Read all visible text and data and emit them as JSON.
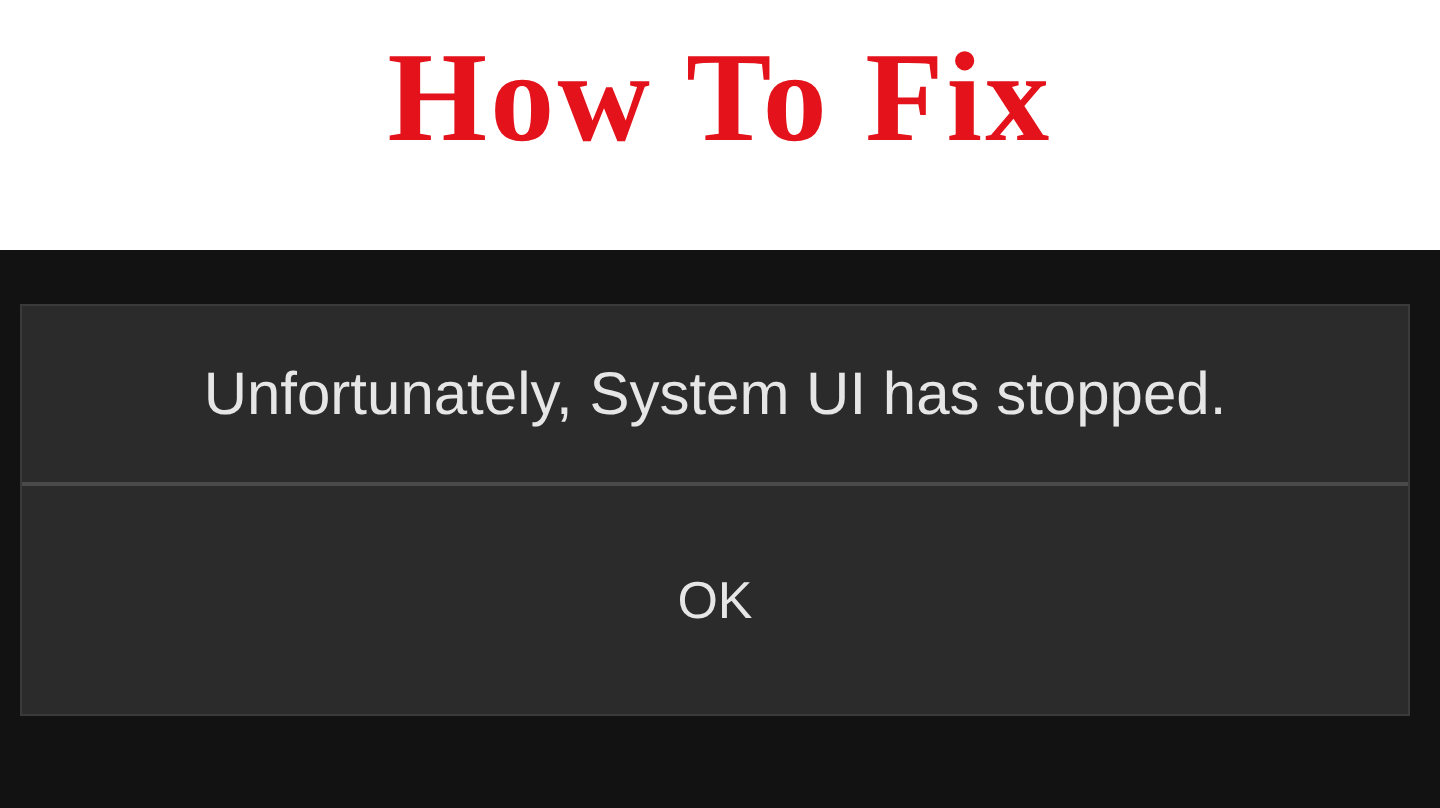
{
  "headline": "How To Fix",
  "dialog": {
    "message": "Unfortunately, System UI has stopped.",
    "buttons": [
      "OK"
    ]
  }
}
